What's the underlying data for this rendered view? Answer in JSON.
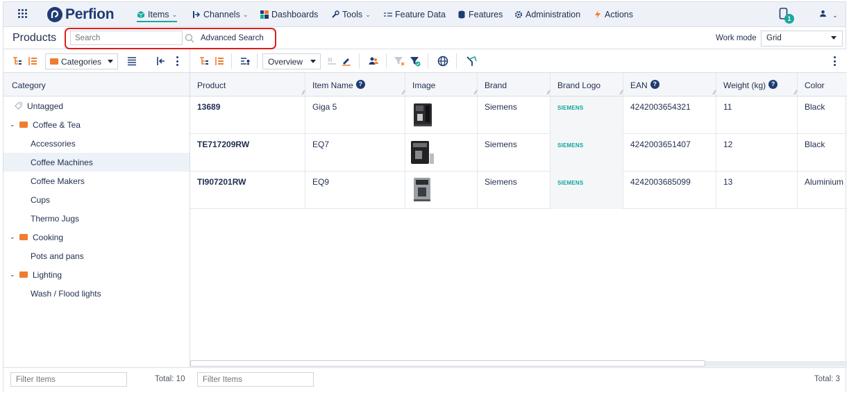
{
  "brand": {
    "name": "Perfion"
  },
  "nav": {
    "items": [
      {
        "label": "Items",
        "icon": "box-icon",
        "has_chevron": true,
        "active": true
      },
      {
        "label": "Channels",
        "icon": "channels-icon",
        "has_chevron": true
      },
      {
        "label": "Dashboards",
        "icon": "dashboard-icon",
        "has_chevron": false
      },
      {
        "label": "Tools",
        "icon": "wrench-icon",
        "has_chevron": true
      },
      {
        "label": "Feature Data",
        "icon": "list-icon",
        "has_chevron": false
      },
      {
        "label": "Features",
        "icon": "database-icon",
        "has_chevron": false
      },
      {
        "label": "Administration",
        "icon": "gear-icon",
        "has_chevron": false
      },
      {
        "label": "Actions",
        "icon": "lightning-icon",
        "has_chevron": false
      }
    ],
    "notification_count": "1"
  },
  "header": {
    "title": "Products",
    "search_placeholder": "Search",
    "advanced_search": "Advanced Search",
    "work_mode_label": "Work mode",
    "work_mode_value": "Grid"
  },
  "left_toolbar": {
    "category_select": "Categories"
  },
  "right_toolbar": {
    "view_select": "Overview"
  },
  "tree": {
    "header": "Category",
    "items": [
      {
        "label": "Untagged",
        "level": 0,
        "type": "tag"
      },
      {
        "label": "Coffee & Tea",
        "level": 0,
        "type": "folder",
        "expanded": true
      },
      {
        "label": "Accessories",
        "level": 1
      },
      {
        "label": "Coffee Machines",
        "level": 1,
        "selected": true
      },
      {
        "label": "Coffee Makers",
        "level": 1
      },
      {
        "label": "Cups",
        "level": 1
      },
      {
        "label": "Thermo Jugs",
        "level": 1
      },
      {
        "label": "Cooking",
        "level": 0,
        "type": "folder",
        "expanded": true
      },
      {
        "label": "Pots and pans",
        "level": 1
      },
      {
        "label": "Lighting",
        "level": 0,
        "type": "folder",
        "expanded": true
      },
      {
        "label": "Wash / Flood lights",
        "level": 1
      }
    ]
  },
  "grid": {
    "columns": [
      "Product",
      "Item Name",
      "Image",
      "Brand",
      "Brand Logo",
      "EAN",
      "Weight (kg)",
      "Color"
    ],
    "help_columns": [
      "Item Name",
      "EAN",
      "Weight (kg)"
    ],
    "rows": [
      {
        "product": "13689",
        "item_name": "Giga 5",
        "brand": "Siemens",
        "brand_logo": "SIEMENS",
        "ean": "4242003654321",
        "weight": "11",
        "color": "Black"
      },
      {
        "product": "TE717209RW",
        "item_name": "EQ7",
        "brand": "Siemens",
        "brand_logo": "SIEMENS",
        "ean": "4242003651407",
        "weight": "12",
        "color": "Black"
      },
      {
        "product": "TI907201RW",
        "item_name": "EQ9",
        "brand": "Siemens",
        "brand_logo": "SIEMENS",
        "ean": "4242003685099",
        "weight": "13",
        "color": "Aluminium"
      }
    ]
  },
  "footer": {
    "left_filter_placeholder": "Filter Items",
    "left_total": "Total: 10",
    "right_filter_placeholder": "Filter Items",
    "right_total": "Total: 3"
  },
  "colors": {
    "accent": "#1aa89a",
    "navy": "#1f3b73",
    "folder": "#f07c30",
    "highlight": "#e01b1b"
  }
}
